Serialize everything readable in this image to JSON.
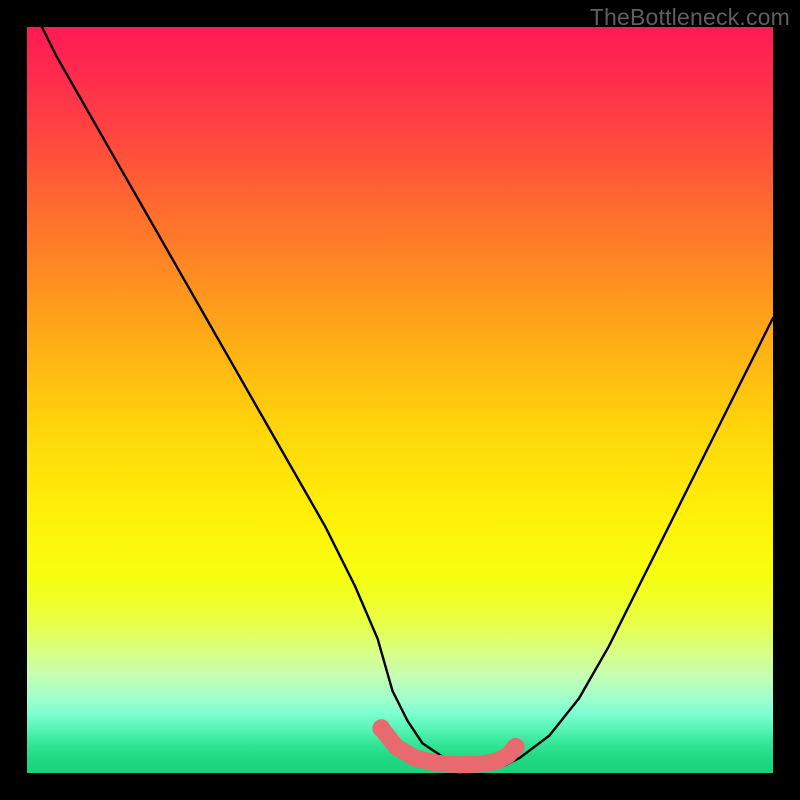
{
  "watermark": "TheBottleneck.com",
  "chart_data": {
    "type": "line",
    "title": "",
    "xlabel": "",
    "ylabel": "",
    "xlim": [
      0,
      100
    ],
    "ylim": [
      0,
      100
    ],
    "grid": false,
    "series": [
      {
        "name": "bottleneck-curve",
        "color": "#000000",
        "x": [
          0,
          4,
          8,
          12,
          16,
          20,
          24,
          28,
          32,
          36,
          40,
          44,
          47,
          49,
          51,
          53,
          56,
          59,
          62,
          64,
          66,
          70,
          74,
          78,
          82,
          86,
          90,
          94,
          98,
          100
        ],
        "y": [
          104,
          96,
          89,
          82,
          75,
          68,
          61,
          54,
          47,
          40,
          33,
          25,
          18,
          11,
          7,
          4,
          2,
          1,
          1,
          1,
          2,
          5,
          10,
          17,
          25,
          33,
          41,
          49,
          57,
          61
        ]
      },
      {
        "name": "optimal-region",
        "color": "#e86a6e",
        "type": "scatter",
        "x": [
          47.5,
          49.5,
          52,
          55,
          58,
          61,
          63,
          64.5,
          65.5
        ],
        "y": [
          6,
          3.5,
          2,
          1.3,
          1.1,
          1.2,
          1.6,
          2.4,
          3.5
        ]
      }
    ],
    "background_gradient": {
      "top": "#ff1a55",
      "mid": "#ffe607",
      "bottom": "#18d37a"
    }
  }
}
